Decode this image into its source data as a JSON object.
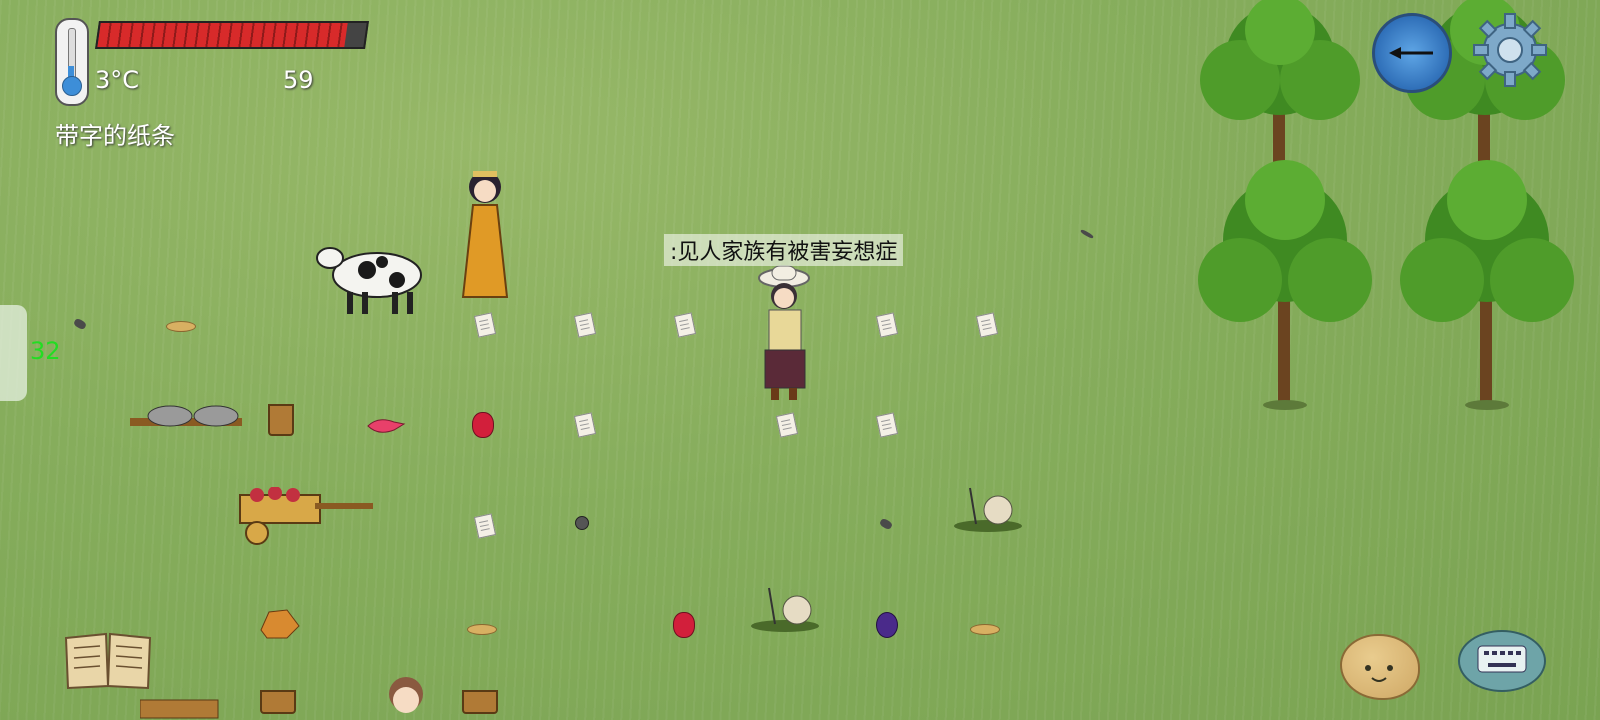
{
  "hud": {
    "temperature": "3°C",
    "food_count": "59",
    "held_item": "带字的纸条",
    "health_fraction": 0.93
  },
  "fps": "32",
  "speech": ":见人家族有被害妄想症",
  "icons": {
    "thermometer": "thermometer-icon",
    "compass": "compass-icon",
    "settings": "gear-icon",
    "book": "book-icon",
    "emote": "emote-face-icon",
    "keyboard": "keyboard-chat-icon"
  },
  "colors": {
    "grass": "#86ad5c",
    "health_red": "#d82a2a",
    "fps_green": "#22dd22"
  }
}
